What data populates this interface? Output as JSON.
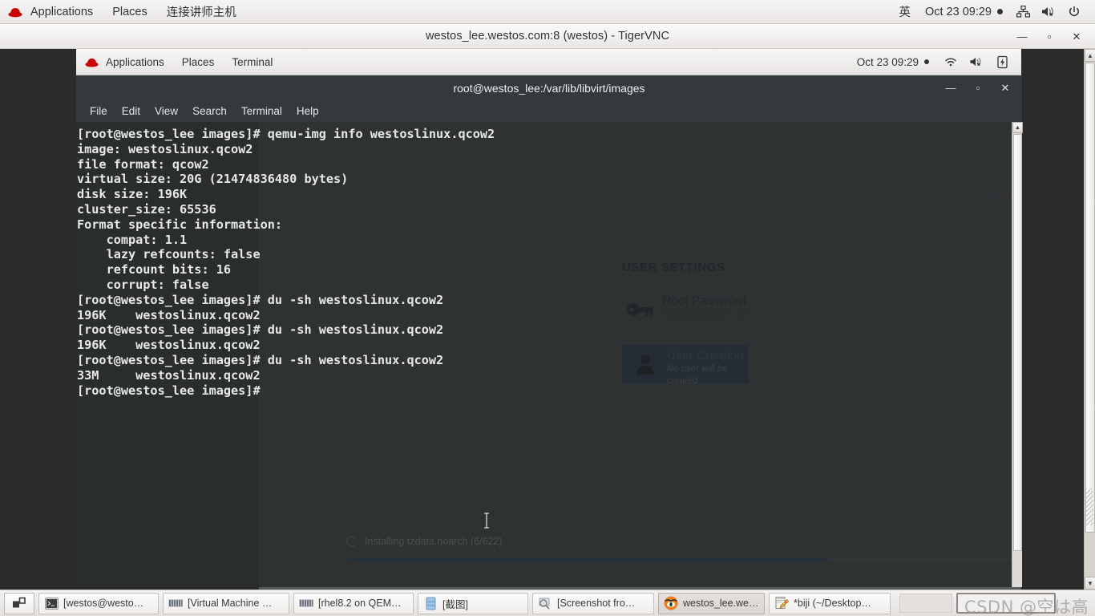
{
  "host_topbar": {
    "icon": "redhat-logo",
    "applications": "Applications",
    "places": "Places",
    "custom_item": "连接讲师主机",
    "input_method": "英",
    "clock": "Oct 23  09:29",
    "icons": [
      "network-icon",
      "volume-muted-icon",
      "power-icon"
    ]
  },
  "vnc_window": {
    "title": "westos_lee.westos.com:8 (westos) - TigerVNC",
    "minimize": "—",
    "maximize": "▫",
    "close": "✕"
  },
  "guest_topbar": {
    "icon": "redhat-logo",
    "applications": "Applications",
    "places": "Places",
    "terminal": "Terminal",
    "clock": "Oct 23  09:29",
    "icons": [
      "wifi-icon",
      "volume-muted-icon",
      "battery-icon"
    ]
  },
  "terminal": {
    "title": "root@westos_lee:/var/lib/libvirt/images",
    "minimize": "—",
    "maximize": "▫",
    "close": "✕",
    "menu": [
      "File",
      "Edit",
      "View",
      "Search",
      "Terminal",
      "Help"
    ],
    "lines": [
      "[root@westos_lee images]# qemu-img info westoslinux.qcow2",
      "image: westoslinux.qcow2",
      "file format: qcow2",
      "virtual size: 20G (21474836480 bytes)",
      "disk size: 196K",
      "cluster_size: 65536",
      "Format specific information:",
      "    compat: 1.1",
      "    lazy refcounts: false",
      "    refcount bits: 16",
      "    corrupt: false",
      "[root@westos_lee images]# du -sh westoslinux.qcow2",
      "196K\twestoslinux.qcow2",
      "[root@westos_lee images]# du -sh westoslinux.qcow2",
      "196K\twestoslinux.qcow2",
      "[root@westos_lee images]# du -sh westoslinux.qcow2",
      "33M\twestoslinux.qcow2",
      "[root@westos_lee images]# "
    ]
  },
  "installer": {
    "section_title": "USER SETTINGS",
    "spokes": [
      {
        "icon": "key-icon",
        "name": "Root Password",
        "status": "Root password is set",
        "selected": false
      },
      {
        "icon": "user-icon",
        "name": "User Creation",
        "status": "No user will be created",
        "selected": true
      }
    ],
    "progress": {
      "label": "Installing tzdata.noarch (6/622)",
      "percent": 69.6,
      "spinner": "spinner-icon",
      "bar_color": "#2f4f75"
    }
  },
  "taskbar": {
    "show_desktop": "show-desktop-icon",
    "buttons": [
      {
        "icon": "terminal-icon",
        "label": "[westos@westo…",
        "active": false
      },
      {
        "icon": "vmm-icon",
        "label": "[Virtual Machine …",
        "active": false
      },
      {
        "icon": "vmm-icon",
        "label": "[rhel8.2 on QEM…",
        "active": false
      },
      {
        "icon": "files-icon",
        "label": "[截图]",
        "active": false
      },
      {
        "icon": "screenshot-icon",
        "label": "[Screenshot fro…",
        "active": false
      },
      {
        "icon": "tigervnc-icon",
        "label": "westos_lee.west…",
        "active": true
      },
      {
        "icon": "gedit-icon",
        "label": "*biji (~/Desktop…",
        "active": false
      }
    ]
  },
  "watermark": "CSDN @空は高"
}
